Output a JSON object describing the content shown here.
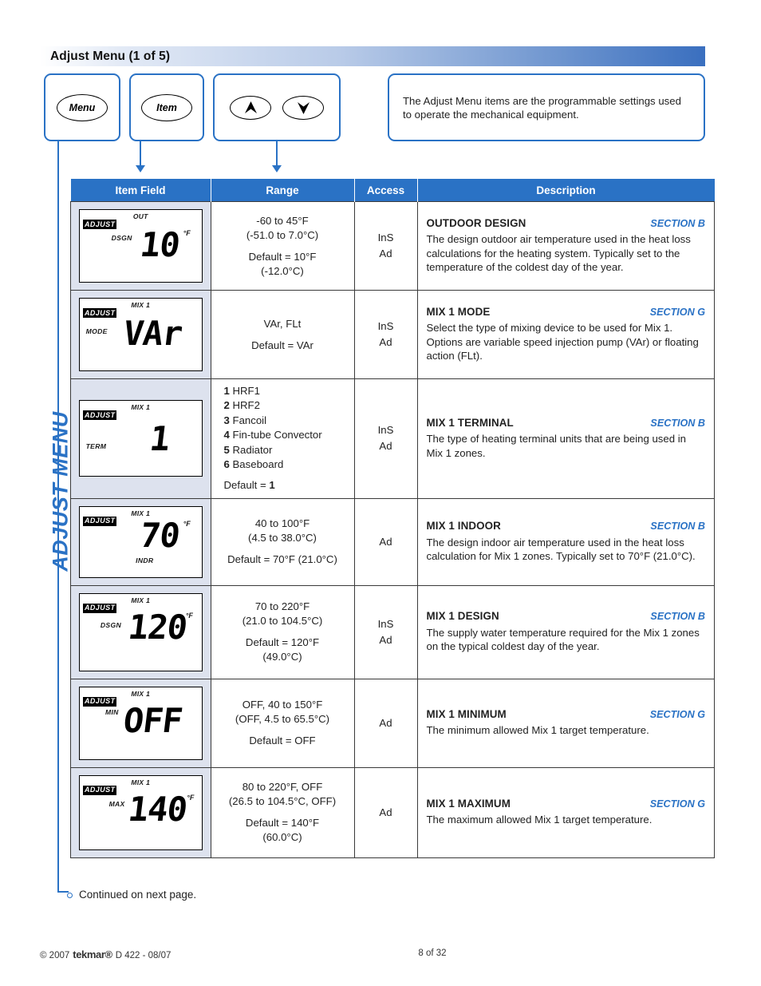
{
  "header": {
    "title": "Adjust Menu (1 of 5)",
    "buttons": [
      {
        "name": "menu",
        "label": "Menu"
      },
      {
        "name": "item",
        "label": "Item"
      },
      {
        "name": "up",
        "label": "▲"
      },
      {
        "name": "down",
        "label": "▼"
      }
    ],
    "note": "The Adjust Menu items are the programmable settings used to operate the mechanical equipment."
  },
  "side_label": "ADJUST MENU",
  "table": {
    "columns": [
      "Item Field",
      "Range",
      "Access",
      "Description"
    ],
    "rows": [
      {
        "lcd": {
          "adjust": "ADJUST",
          "zone": "OUT",
          "field": "DSGN",
          "value": "10",
          "unit": "°F"
        },
        "range": [
          "-60 to 45°F\n(-51.0 to 7.0°C)",
          "Default = 10°F\n(-12.0°C)"
        ],
        "access": "InS\nAd",
        "title": "OUTDOOR DESIGN",
        "section": "SECTION B",
        "body": "The design outdoor air temperature used in the heat loss calculations for the heating system. Typically set to the temperature of the coldest day of the year."
      },
      {
        "lcd": {
          "adjust": "ADJUST",
          "zone": "MIX 1",
          "field": "MODE",
          "value": "VAr",
          "unit": ""
        },
        "range": [
          "VAr, FLt",
          "Default = VAr"
        ],
        "access": "InS\nAd",
        "title": "MIX 1 MODE",
        "section": "SECTION G",
        "body": "Select the type of mixing device to be used for Mix 1. Options are variable speed injection pump (VAr) or floating action (FLt)."
      },
      {
        "lcd": {
          "adjust": "ADJUST",
          "zone": "MIX 1",
          "field": "TERM",
          "value": "1",
          "unit": ""
        },
        "range_options": [
          {
            "num": "1",
            "text": "HRF1"
          },
          {
            "num": "2",
            "text": "HRF2"
          },
          {
            "num": "3",
            "text": "Fancoil"
          },
          {
            "num": "4",
            "text": "Fin-tube Convector"
          },
          {
            "num": "5",
            "text": "Radiator"
          },
          {
            "num": "6",
            "text": "Baseboard"
          }
        ],
        "range_default_prefix": "Default = ",
        "range_default_value": "1",
        "access": "InS\nAd",
        "title": "MIX 1 TERMINAL",
        "section": "SECTION B",
        "body": "The type of heating terminal units that are being used in Mix 1 zones."
      },
      {
        "lcd": {
          "adjust": "ADJUST",
          "zone": "MIX 1",
          "field": "INDR",
          "value": "70",
          "unit": "°F"
        },
        "range": [
          "40 to 100°F\n(4.5 to 38.0°C)",
          "Default = 70°F (21.0°C)"
        ],
        "access": "Ad",
        "title": "MIX 1 INDOOR",
        "section": "SECTION B",
        "body": "The design indoor air temperature used in the heat loss calculation for Mix 1 zones. Typically set to 70°F (21.0°C)."
      },
      {
        "lcd": {
          "adjust": "ADJUST",
          "zone": "MIX 1",
          "field": "DSGN",
          "value": "120",
          "unit": "°F"
        },
        "range": [
          "70 to 220°F\n(21.0 to 104.5°C)",
          "Default = 120°F\n(49.0°C)"
        ],
        "access": "InS\nAd",
        "title": "MIX 1 DESIGN",
        "section": "SECTION B",
        "body": "The supply water temperature required for the Mix 1 zones on the typical coldest day of the year."
      },
      {
        "lcd": {
          "adjust": "ADJUST",
          "zone": "MIX 1",
          "field": "MIN",
          "value": "OFF",
          "unit": ""
        },
        "range": [
          "OFF, 40 to 150°F\n(OFF, 4.5 to 65.5°C)",
          "Default = OFF"
        ],
        "access": "Ad",
        "title": "MIX 1 MINIMUM",
        "section": "SECTION G",
        "body": "The minimum allowed Mix 1 target temperature."
      },
      {
        "lcd": {
          "adjust": "ADJUST",
          "zone": "MIX 1",
          "field": "MAX",
          "value": "140",
          "unit": "°F"
        },
        "range": [
          "80 to 220°F, OFF\n(26.5 to 104.5°C, OFF)",
          "Default = 140°F\n(60.0°C)"
        ],
        "access": "Ad",
        "title": "MIX 1 MAXIMUM",
        "section": "SECTION G",
        "body": "The maximum allowed Mix 1 target temperature."
      }
    ]
  },
  "continued": "Continued on next page.",
  "footer": {
    "copyright": "© 2007",
    "brand": "tekmar®",
    "doc": "D 422 - 08/07",
    "page": "8 of 32"
  },
  "colors": {
    "accent_blue": "#2a72c5",
    "lcd_cell_bg": "#dde2ee"
  }
}
